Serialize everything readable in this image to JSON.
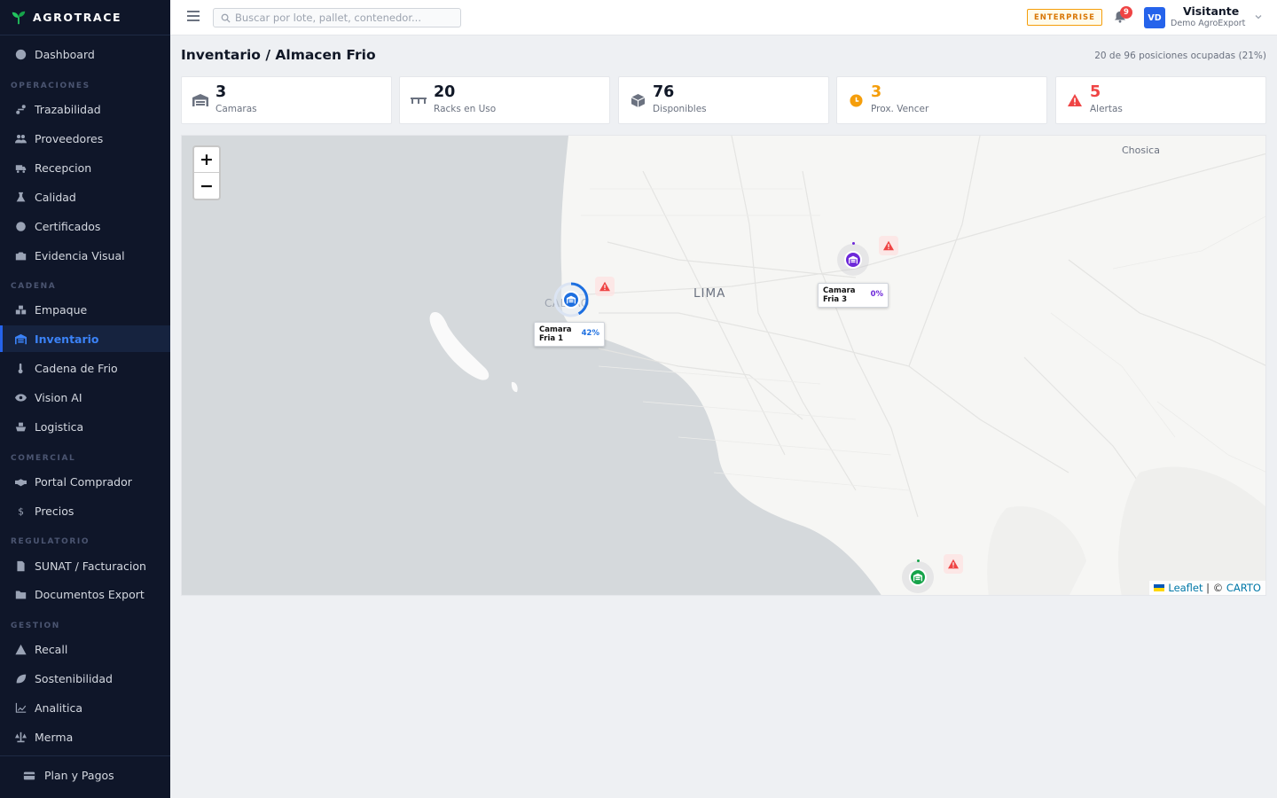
{
  "brand": {
    "name": "AGROTRACE"
  },
  "sidebar": {
    "dashboard": "Dashboard",
    "sections": {
      "operaciones": "OPERACIONES",
      "cadena": "CADENA",
      "comercial": "COMERCIAL",
      "regulatorio": "REGULATORIO",
      "gestion": "GESTION"
    },
    "items": {
      "trazabilidad": "Trazabilidad",
      "proveedores": "Proveedores",
      "recepcion": "Recepcion",
      "calidad": "Calidad",
      "certificados": "Certificados",
      "evidencia": "Evidencia Visual",
      "empaque": "Empaque",
      "inventario": "Inventario",
      "cadena_frio": "Cadena de Frio",
      "vision_ai": "Vision AI",
      "logistica": "Logistica",
      "portal": "Portal Comprador",
      "precios": "Precios",
      "sunat": "SUNAT / Facturacion",
      "documentos": "Documentos Export",
      "recall": "Recall",
      "sostenibilidad": "Sostenibilidad",
      "analitica": "Analitica",
      "merma": "Merma"
    },
    "plan": "Plan y Pagos"
  },
  "topbar": {
    "search_placeholder": "Buscar por lote, pallet, contenedor...",
    "plan_badge": "ENTERPRISE",
    "notifications": "9",
    "avatar_initials": "VD",
    "user_name": "Visitante",
    "user_org": "Demo AgroExport"
  },
  "page": {
    "title": "Inventario / Almacen Frio",
    "occupancy": "20 de 96 posiciones ocupadas (21%)"
  },
  "stats": [
    {
      "value": "3",
      "label": "Camaras",
      "icon": "warehouse-icon",
      "color": "#111827"
    },
    {
      "value": "20",
      "label": "Racks en Uso",
      "icon": "rack-icon",
      "color": "#111827"
    },
    {
      "value": "76",
      "label": "Disponibles",
      "icon": "box-icon",
      "color": "#111827"
    },
    {
      "value": "3",
      "label": "Prox. Vencer",
      "icon": "clock-icon",
      "color": "#f59e0b"
    },
    {
      "value": "5",
      "label": "Alertas",
      "icon": "alert-icon",
      "color": "#ef4444"
    }
  ],
  "map": {
    "zoom_in": "+",
    "zoom_out": "−",
    "cities": {
      "lima": "LIMA",
      "callao": "CALLAO",
      "chosica": "Chosica"
    },
    "cameras": [
      {
        "name_line1": "Camara",
        "name_line2": "Fria 1",
        "occupancy": "42%",
        "occupancy_value": 0.42,
        "color": "#1d6fe0"
      },
      {
        "name_line1": "Camara",
        "name_line2": "Fria 3",
        "occupancy": "0%",
        "occupancy_value": 0.0,
        "color": "#6d28d9"
      },
      {
        "occupancy_value": 0.0,
        "color": "#16a34a"
      }
    ],
    "attribution": {
      "leaflet": "Leaflet",
      "sep": " | © ",
      "carto": "CARTO"
    }
  }
}
